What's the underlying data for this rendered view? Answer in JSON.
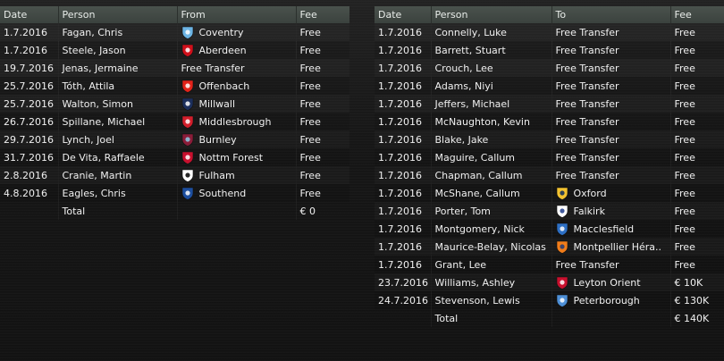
{
  "incoming": {
    "headers": {
      "date": "Date",
      "person": "Person",
      "from": "From",
      "fee": "Fee"
    },
    "rows": [
      {
        "date": "1.7.2016",
        "person": "Fagan, Chris",
        "club": "Coventry",
        "badge": "coventry-badge-icon",
        "fee": "Free"
      },
      {
        "date": "1.7.2016",
        "person": "Steele, Jason",
        "club": "Aberdeen",
        "badge": "aberdeen-badge-icon",
        "fee": "Free"
      },
      {
        "date": "19.7.2016",
        "person": "Jenas, Jermaine",
        "club": "Free Transfer",
        "badge": "",
        "fee": "Free"
      },
      {
        "date": "25.7.2016",
        "person": "Tóth, Attila",
        "club": "Offenbach",
        "badge": "offenbach-badge-icon",
        "fee": "Free"
      },
      {
        "date": "25.7.2016",
        "person": "Walton, Simon",
        "club": "Millwall",
        "badge": "millwall-badge-icon",
        "fee": "Free"
      },
      {
        "date": "26.7.2016",
        "person": "Spillane, Michael",
        "club": "Middlesbrough",
        "badge": "middlesbrough-badge-icon",
        "fee": "Free"
      },
      {
        "date": "29.7.2016",
        "person": "Lynch, Joel",
        "club": "Burnley",
        "badge": "burnley-badge-icon",
        "fee": "Free"
      },
      {
        "date": "31.7.2016",
        "person": "De Vita, Raffaele",
        "club": "Nottm Forest",
        "badge": "nottm-forest-badge-icon",
        "fee": "Free"
      },
      {
        "date": "2.8.2016",
        "person": "Cranie, Martin",
        "club": "Fulham",
        "badge": "fulham-badge-icon",
        "fee": "Free"
      },
      {
        "date": "4.8.2016",
        "person": "Eagles, Chris",
        "club": "Southend",
        "badge": "southend-badge-icon",
        "fee": "Free"
      }
    ],
    "total": {
      "label": "Total",
      "fee": "€ 0"
    }
  },
  "outgoing": {
    "headers": {
      "date": "Date",
      "person": "Person",
      "to": "To",
      "fee": "Fee"
    },
    "rows": [
      {
        "date": "1.7.2016",
        "person": "Connelly, Luke",
        "club": "Free Transfer",
        "badge": "",
        "fee": "Free"
      },
      {
        "date": "1.7.2016",
        "person": "Barrett, Stuart",
        "club": "Free Transfer",
        "badge": "",
        "fee": "Free"
      },
      {
        "date": "1.7.2016",
        "person": "Crouch, Lee",
        "club": "Free Transfer",
        "badge": "",
        "fee": "Free"
      },
      {
        "date": "1.7.2016",
        "person": "Adams, Niyi",
        "club": "Free Transfer",
        "badge": "",
        "fee": "Free"
      },
      {
        "date": "1.7.2016",
        "person": "Jeffers, Michael",
        "club": "Free Transfer",
        "badge": "",
        "fee": "Free"
      },
      {
        "date": "1.7.2016",
        "person": "McNaughton, Kevin",
        "club": "Free Transfer",
        "badge": "",
        "fee": "Free"
      },
      {
        "date": "1.7.2016",
        "person": "Blake, Jake",
        "club": "Free Transfer",
        "badge": "",
        "fee": "Free"
      },
      {
        "date": "1.7.2016",
        "person": "Maguire, Callum",
        "club": "Free Transfer",
        "badge": "",
        "fee": "Free"
      },
      {
        "date": "1.7.2016",
        "person": "Chapman, Callum",
        "club": "Free Transfer",
        "badge": "",
        "fee": "Free"
      },
      {
        "date": "1.7.2016",
        "person": "McShane, Callum",
        "club": "Oxford",
        "badge": "oxford-badge-icon",
        "fee": "Free"
      },
      {
        "date": "1.7.2016",
        "person": "Porter, Tom",
        "club": "Falkirk",
        "badge": "falkirk-badge-icon",
        "fee": "Free"
      },
      {
        "date": "1.7.2016",
        "person": "Montgomery, Nick",
        "club": "Macclesfield",
        "badge": "macclesfield-badge-icon",
        "fee": "Free"
      },
      {
        "date": "1.7.2016",
        "person": "Maurice-Belay, Nicolas",
        "club": "Montpellier Héra..",
        "badge": "montpellier-badge-icon",
        "fee": "Free"
      },
      {
        "date": "1.7.2016",
        "person": "Grant, Lee",
        "club": "Free Transfer",
        "badge": "",
        "fee": "Free"
      },
      {
        "date": "23.7.2016",
        "person": "Williams, Ashley",
        "club": "Leyton Orient",
        "badge": "leyton-orient-badge-icon",
        "fee": "€ 10K"
      },
      {
        "date": "24.7.2016",
        "person": "Stevenson, Lewis",
        "club": "Peterborough",
        "badge": "peterborough-badge-icon",
        "fee": "€ 130K"
      }
    ],
    "total": {
      "label": "Total",
      "fee": "€ 140K"
    }
  },
  "badge_colors": {
    "coventry-badge-icon": {
      "primary": "#6cb4e4",
      "secondary": "#ffffff"
    },
    "aberdeen-badge-icon": {
      "primary": "#d0101b",
      "secondary": "#ffffff"
    },
    "offenbach-badge-icon": {
      "primary": "#e2231a",
      "secondary": "#ffffff"
    },
    "millwall-badge-icon": {
      "primary": "#1c2f5c",
      "secondary": "#ffffff"
    },
    "middlesbrough-badge-icon": {
      "primary": "#d21e2b",
      "secondary": "#ffffff"
    },
    "burnley-badge-icon": {
      "primary": "#8a1d39",
      "secondary": "#8ccce5"
    },
    "nottm-forest-badge-icon": {
      "primary": "#c8102e",
      "secondary": "#ffffff"
    },
    "fulham-badge-icon": {
      "primary": "#ffffff",
      "secondary": "#000000"
    },
    "southend-badge-icon": {
      "primary": "#1d4e9e",
      "secondary": "#ffffff"
    },
    "oxford-badge-icon": {
      "primary": "#f2c230",
      "secondary": "#0c2a5e"
    },
    "falkirk-badge-icon": {
      "primary": "#ffffff",
      "secondary": "#1e3c8c"
    },
    "macclesfield-badge-icon": {
      "primary": "#2d6fc4",
      "secondary": "#ffffff"
    },
    "montpellier-badge-icon": {
      "primary": "#f07c1a",
      "secondary": "#1f3b7a"
    },
    "leyton-orient-badge-icon": {
      "primary": "#c8102e",
      "secondary": "#ffffff"
    },
    "peterborough-badge-icon": {
      "primary": "#4d8fd6",
      "secondary": "#ffffff"
    }
  }
}
